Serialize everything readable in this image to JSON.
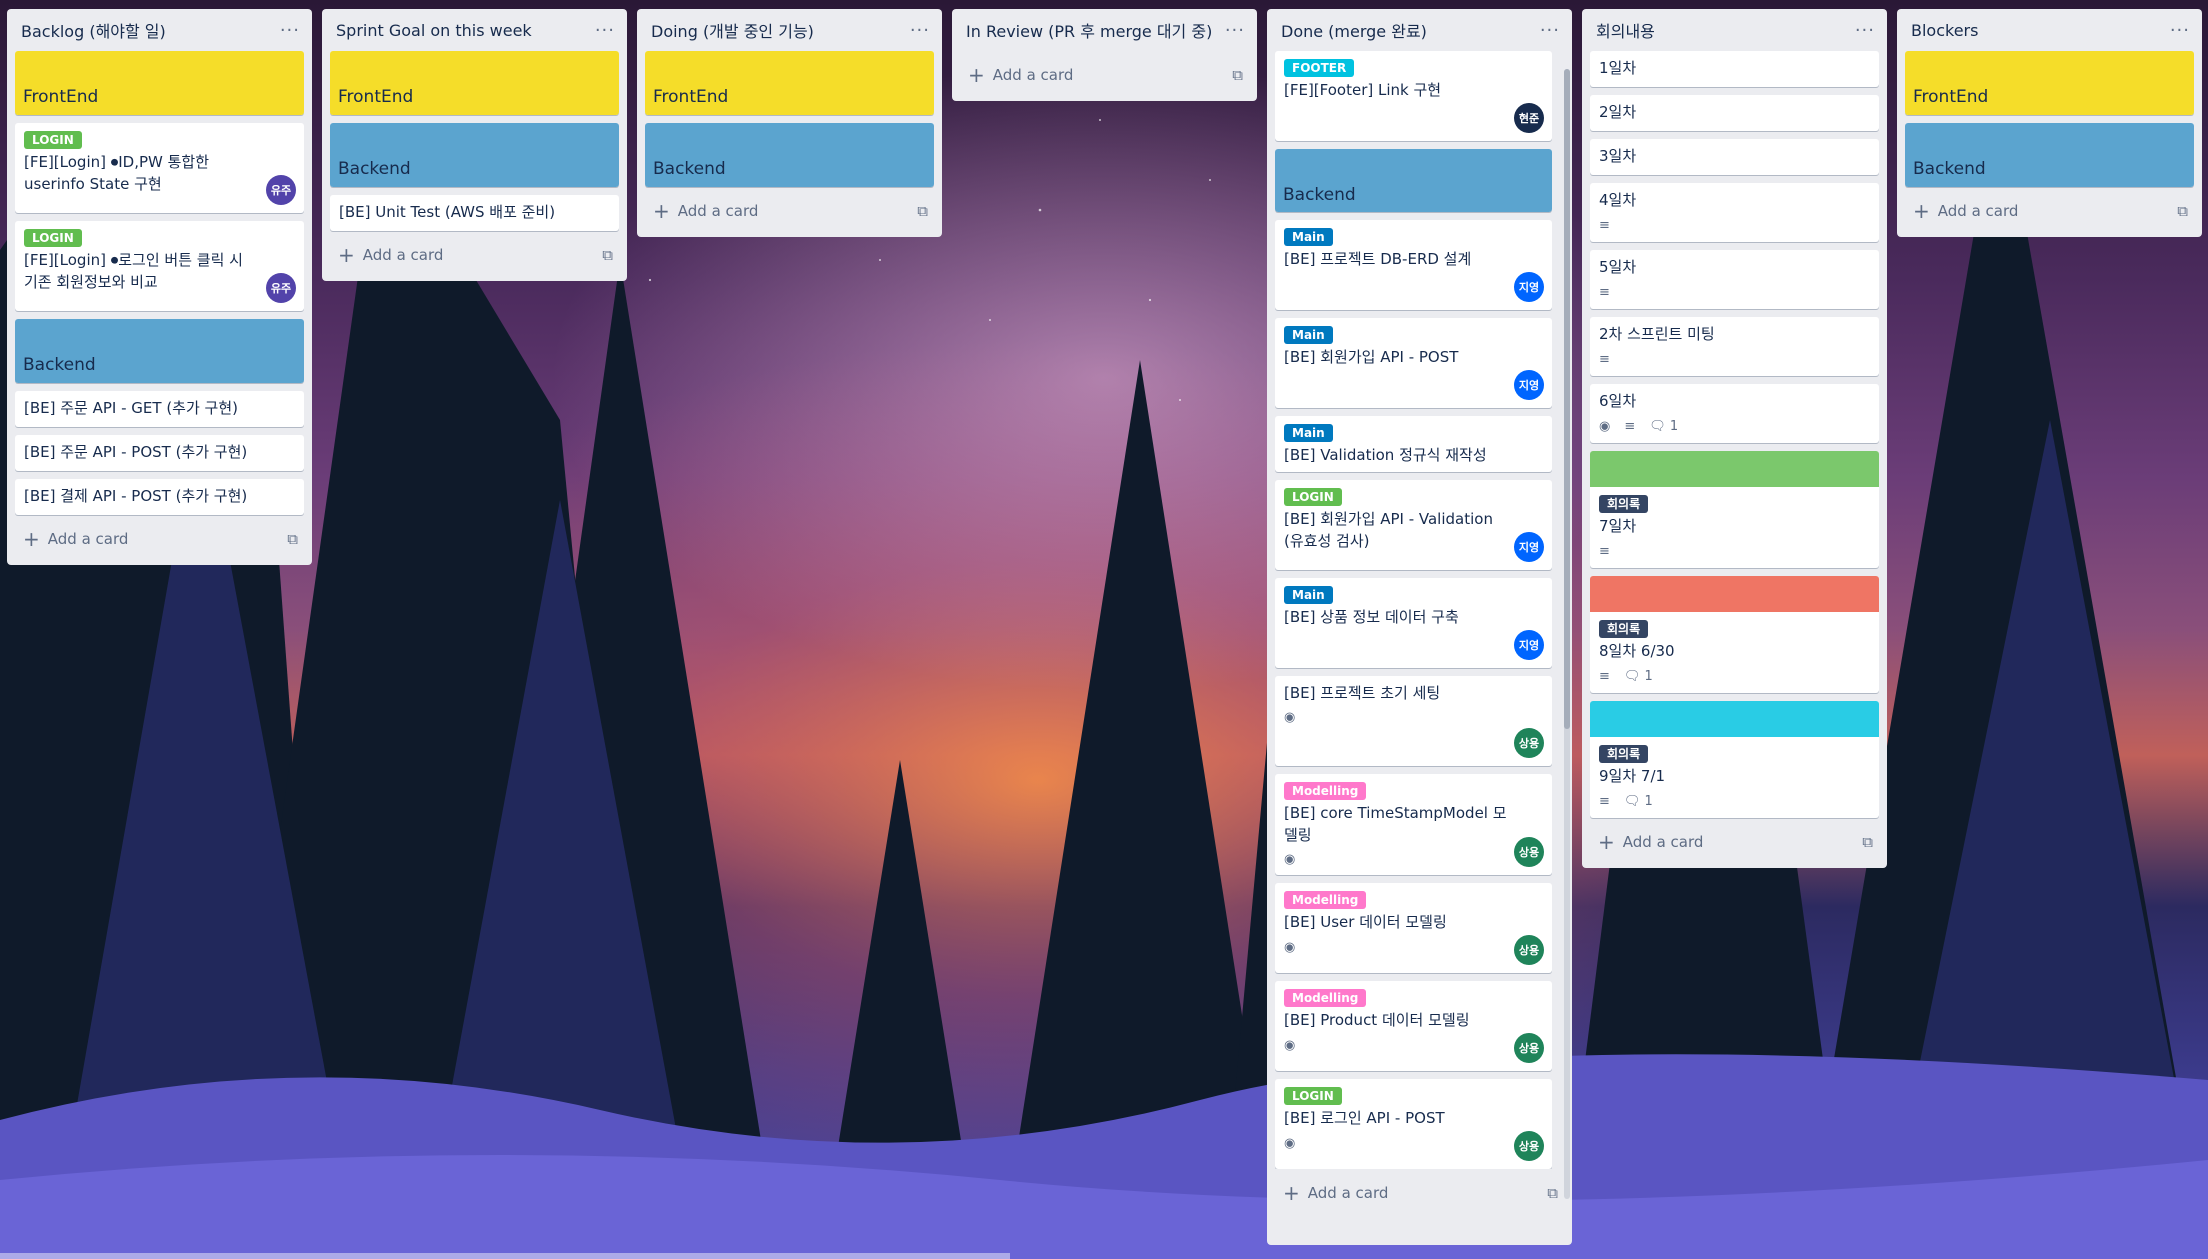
{
  "lists": [
    {
      "title": "Backlog (해야할 일)",
      "menu": "···",
      "cards": [
        {
          "type": "cover",
          "cover_color": "#f5dd29",
          "title": "FrontEnd"
        },
        {
          "type": "card",
          "label": "LOGIN",
          "label_color": "#61bd4f",
          "title": "[FE][Login] ⏺ID,PW 통합한 userinfo State 구현",
          "avatar": "유주",
          "avatar_color": "#5243aa"
        },
        {
          "type": "card",
          "label": "LOGIN",
          "label_color": "#61bd4f",
          "title": "[FE][Login] ⏺로그인 버튼 클릭 시 기존 회원정보와 비교",
          "avatar": "유주",
          "avatar_color": "#5243aa"
        },
        {
          "type": "cover",
          "cover_color": "#5ba4cf",
          "title": "Backend"
        },
        {
          "type": "card",
          "title": "[BE] 주문 API - GET (추가 구현)"
        },
        {
          "type": "card",
          "title": "[BE] 주문 API - POST (추가 구현)"
        },
        {
          "type": "card",
          "title": "[BE] 결제 API - POST (추가 구현)"
        }
      ],
      "add_card": "Add a card"
    },
    {
      "title": "Sprint Goal on this week",
      "menu": "···",
      "cards": [
        {
          "type": "cover",
          "cover_color": "#f5dd29",
          "title": "FrontEnd"
        },
        {
          "type": "cover",
          "cover_color": "#5ba4cf",
          "title": "Backend"
        },
        {
          "type": "card",
          "title": "[BE] Unit Test (AWS 배포 준비)"
        }
      ],
      "add_card": "Add a card"
    },
    {
      "title": "Doing (개발 중인 기능)",
      "menu": "···",
      "cards": [
        {
          "type": "cover",
          "cover_color": "#f5dd29",
          "title": "FrontEnd"
        },
        {
          "type": "cover",
          "cover_color": "#5ba4cf",
          "title": "Backend"
        }
      ],
      "add_card": "Add a card"
    },
    {
      "title": "In Review (PR 후 merge 대기 중)",
      "menu": "···",
      "cards": [],
      "add_card": "Add a card"
    },
    {
      "title": "Done (merge 완료)",
      "menu": "···",
      "cards": [
        {
          "type": "card",
          "label": "FOOTER",
          "label_color": "#00c2e0",
          "title": "[FE][Footer] Link 구현",
          "avatar": "현준",
          "avatar_color": "#172b4d"
        },
        {
          "type": "cover",
          "cover_color": "#5ba4cf",
          "title": "Backend"
        },
        {
          "type": "card",
          "label": "Main",
          "label_color": "#0079bf",
          "title": "[BE] 프로젝트 DB-ERD 설계",
          "avatar": "지영",
          "avatar_color": "#0065ff"
        },
        {
          "type": "card",
          "label": "Main",
          "label_color": "#0079bf",
          "title": "[BE] 회원가입 API - POST",
          "avatar": "지영",
          "avatar_color": "#0065ff"
        },
        {
          "type": "card",
          "label": "Main",
          "label_color": "#0079bf",
          "title": "[BE] Validation 정규식 재작성"
        },
        {
          "type": "card",
          "label": "LOGIN",
          "label_color": "#61bd4f",
          "title": "[BE] 회원가입 API - Validation (유효성 검사)",
          "avatar": "지영",
          "avatar_color": "#0065ff"
        },
        {
          "type": "card",
          "label": "Main",
          "label_color": "#0079bf",
          "title": "[BE] 상품 정보 데이터 구축",
          "avatar": "지영",
          "avatar_color": "#0065ff"
        },
        {
          "type": "card",
          "title": "[BE] 프로젝트 초기 세팅",
          "watch": true,
          "avatar": "상용",
          "avatar_color": "#1f845a"
        },
        {
          "type": "card",
          "label": "Modelling",
          "label_color": "#ff78cb",
          "title": "[BE] core TimeStampModel 모델링",
          "watch": true,
          "avatar": "상용",
          "avatar_color": "#1f845a"
        },
        {
          "type": "card",
          "label": "Modelling",
          "label_color": "#ff78cb",
          "title": "[BE] User 데이터 모델링",
          "watch": true,
          "avatar": "상용",
          "avatar_color": "#1f845a"
        },
        {
          "type": "card",
          "label": "Modelling",
          "label_color": "#ff78cb",
          "title": "[BE] Product 데이터 모델링",
          "watch": true,
          "avatar": "상용",
          "avatar_color": "#1f845a"
        },
        {
          "type": "card",
          "label": "LOGIN",
          "label_color": "#61bd4f",
          "title": "[BE] 로그인 API - POST",
          "watch": true,
          "avatar": "상용",
          "avatar_color": "#1f845a"
        }
      ],
      "add_card": "Add a card"
    },
    {
      "title": "회의내용",
      "menu": "···",
      "cards": [
        {
          "type": "card",
          "title": "1일차"
        },
        {
          "type": "card",
          "title": "2일차"
        },
        {
          "type": "card",
          "title": "3일차"
        },
        {
          "type": "card",
          "title": "4일차",
          "desc": true
        },
        {
          "type": "card",
          "title": "5일차",
          "desc": true
        },
        {
          "type": "card",
          "title": "2차 스프린트 미팅",
          "desc": true
        },
        {
          "type": "card",
          "title": "6일차",
          "watch": true,
          "desc": true,
          "comments": "1"
        },
        {
          "type": "color",
          "cover_color": "#7bc86c",
          "label": "회의록",
          "title": "7일차",
          "desc": true
        },
        {
          "type": "color",
          "cover_color": "#ef7564",
          "label": "회의록",
          "title": "8일차 6/30",
          "desc": true,
          "comments": "1"
        },
        {
          "type": "color",
          "cover_color": "#29cce5",
          "label": "회의록",
          "title": "9일차 7/1",
          "desc": true,
          "comments": "1"
        }
      ],
      "add_card": "Add a card"
    },
    {
      "title": "Blockers",
      "menu": "···",
      "cards": [
        {
          "type": "cover",
          "cover_color": "#f5dd29",
          "title": "FrontEnd"
        },
        {
          "type": "cover",
          "cover_color": "#5ba4cf",
          "title": "Backend"
        }
      ],
      "add_card": "Add a card"
    }
  ]
}
